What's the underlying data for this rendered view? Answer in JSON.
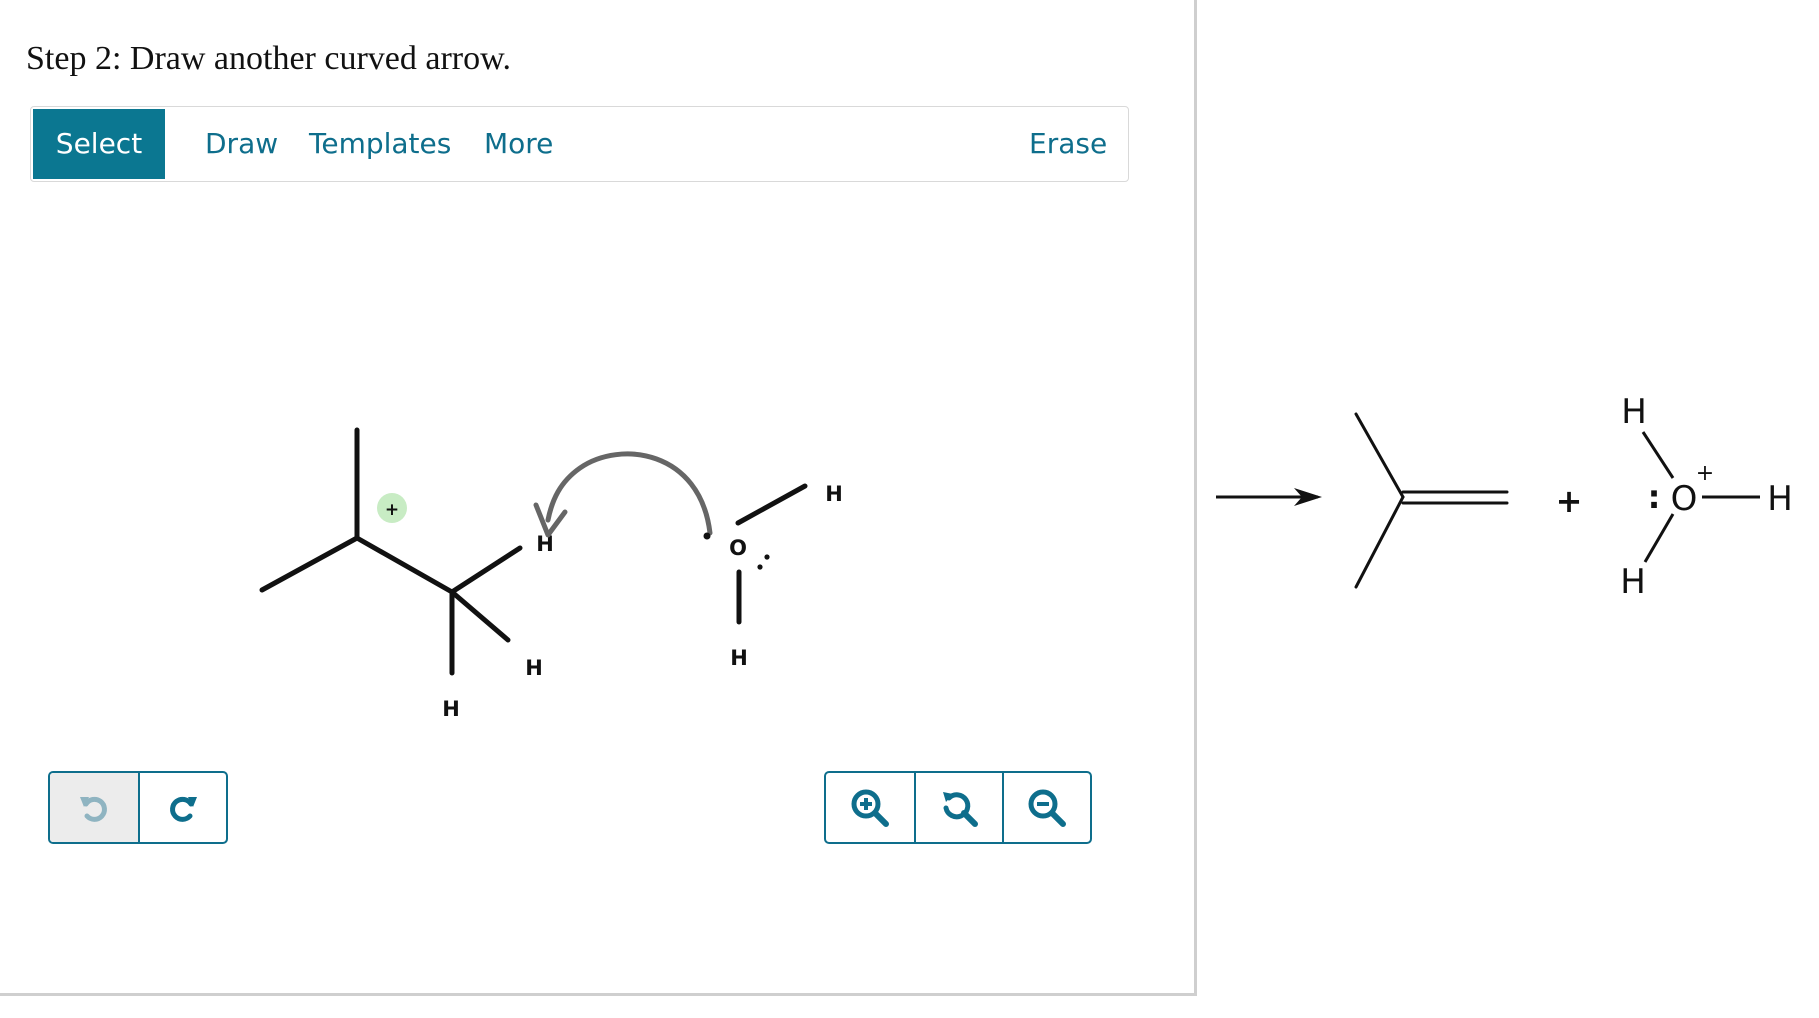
{
  "step": {
    "title": "Step 2: Draw another curved arrow."
  },
  "toolbar": {
    "select_label": "Select",
    "draw_label": "Draw",
    "templates_label": "Templates",
    "more_label": "More",
    "erase_label": "Erase",
    "active_tool": "Select"
  },
  "canvas": {
    "atoms": {
      "h_top": "H",
      "h_mid": "H",
      "h_low": "H",
      "o_atom": "O",
      "h_o_top": "H",
      "h_o_bottom": "H",
      "charge": "+"
    }
  },
  "history_buttons": [
    {
      "name": "undo",
      "icon": "undo-icon",
      "enabled": false
    },
    {
      "name": "redo",
      "icon": "redo-icon",
      "enabled": true
    }
  ],
  "zoom_buttons": [
    {
      "name": "zoom-in",
      "icon": "zoom-in-icon"
    },
    {
      "name": "zoom-reset",
      "icon": "zoom-reset-icon"
    },
    {
      "name": "zoom-out",
      "icon": "zoom-out-icon"
    }
  ],
  "product": {
    "plus_sign": "+",
    "hydronium": {
      "h_top": "H",
      "o_atom": "O",
      "charge": "+",
      "lone_pair": ":",
      "h_right": "H",
      "h_bottom": "H"
    }
  },
  "colors": {
    "accent": "#0b7791",
    "link": "#0e6e8c",
    "charge_highlight": "#c8ecc4",
    "arrow_gray": "#666666"
  }
}
